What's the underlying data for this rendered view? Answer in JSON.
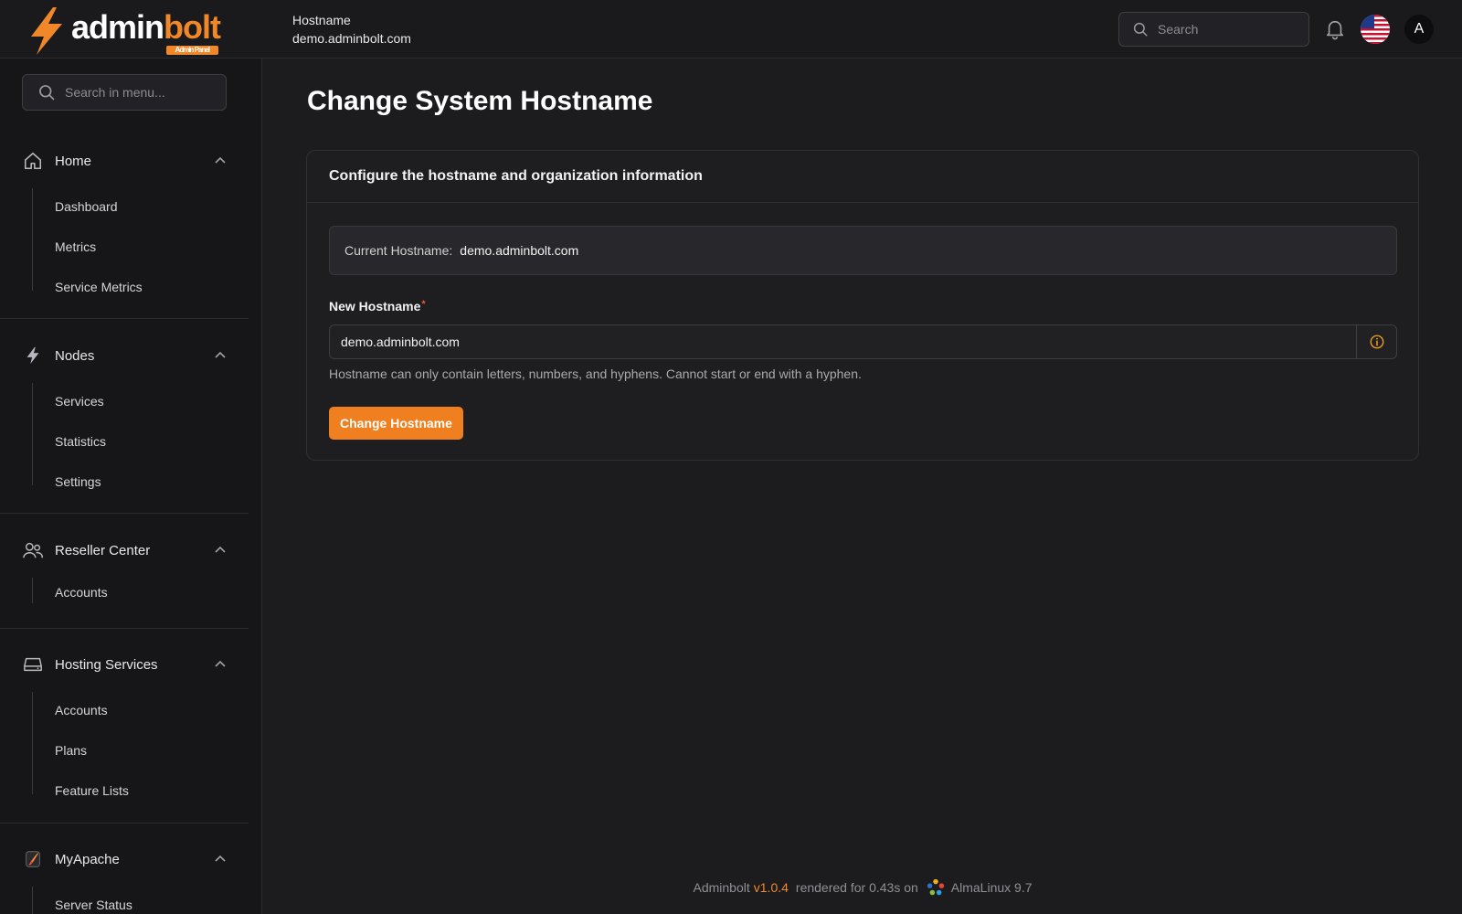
{
  "brand": {
    "name_part1": "admin",
    "name_part2": "bolt",
    "badge": "Admin Panel",
    "accent": "#f0882a"
  },
  "header": {
    "context_label": "Hostname",
    "context_value": "demo.adminbolt.com",
    "search_placeholder": "Search",
    "avatar_initial": "A",
    "language_flag": "us-flag-icon"
  },
  "sidebar": {
    "search_placeholder": "Search in menu...",
    "groups": [
      {
        "label": "Home",
        "icon": "home-icon",
        "items": [
          "Dashboard",
          "Metrics",
          "Service Metrics"
        ]
      },
      {
        "label": "Nodes",
        "icon": "bolt-icon",
        "items": [
          "Services",
          "Statistics",
          "Settings"
        ]
      },
      {
        "label": "Reseller Center",
        "icon": "users-icon",
        "items": [
          "Accounts"
        ]
      },
      {
        "label": "Hosting Services",
        "icon": "server-icon",
        "items": [
          "Accounts",
          "Plans",
          "Feature Lists"
        ]
      },
      {
        "label": "MyApache",
        "icon": "apache-feather-icon",
        "items": [
          "Server Status"
        ]
      }
    ]
  },
  "main": {
    "title": "Change System Hostname",
    "card_heading": "Configure the hostname and organization information",
    "current_label": "Current Hostname:",
    "current_value": "demo.adminbolt.com",
    "field_label": "New Hostname",
    "field_required_mark": "*",
    "field_value": "demo.adminbolt.com",
    "help_text": "Hostname can only contain letters, numbers, and hyphens. Cannot start or end with a hyphen.",
    "submit_label": "Change Hostname"
  },
  "footer": {
    "prefix": "Adminbolt",
    "version": "v1.0.4",
    "rendered": "rendered for 0.43s on",
    "os": "AlmaLinux 9.7"
  }
}
